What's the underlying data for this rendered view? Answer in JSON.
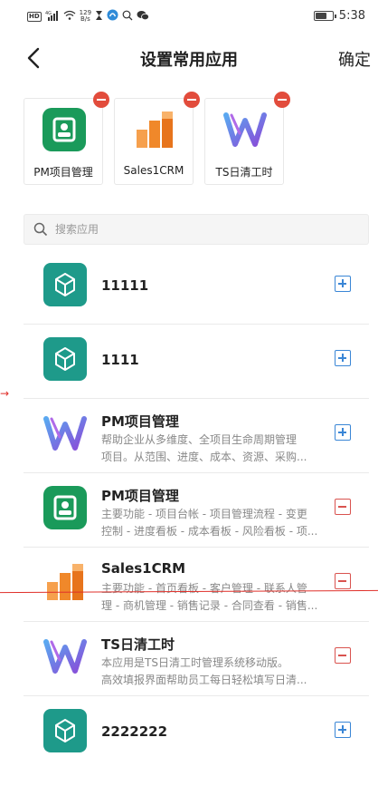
{
  "status_bar": {
    "hd_badge": "HD",
    "net_type": "4G",
    "net_speed_value": "129",
    "net_speed_unit": "B/s",
    "time": "5:38",
    "battery_level": 0.7,
    "icons": [
      "hd-icon",
      "signal-icon",
      "wifi-icon",
      "hourglass-icon",
      "app-icon",
      "search-icon",
      "wechat-icon",
      "battery-icon"
    ]
  },
  "header": {
    "title": "设置常用应用",
    "confirm_label": "确定",
    "back_icon": "chevron-left-icon"
  },
  "selected_apps": [
    {
      "label": "PM项目管理",
      "icon": "pm-green-icon"
    },
    {
      "label": "Sales1CRM",
      "icon": "sales-bars-icon"
    },
    {
      "label": "TS日清工时",
      "icon": "ts-wave-icon"
    }
  ],
  "search": {
    "placeholder": "搜索应用",
    "value": ""
  },
  "apps": [
    {
      "name": "11111",
      "desc": [],
      "icon": "cube-icon",
      "action": "add"
    },
    {
      "name": "1111",
      "desc": [],
      "icon": "cube-icon",
      "action": "add"
    },
    {
      "name": "PM项目管理",
      "desc": [
        "帮助企业从多维度、全项目生命周期管理",
        "项目。从范围、进度、成本、资源、采购..."
      ],
      "icon": "ts-wave-icon",
      "action": "add"
    },
    {
      "name": "PM项目管理",
      "desc": [
        "主要功能 - 项目台帐 - 项目管理流程 - 变更",
        "控制 - 进度看板 - 成本看板 - 风险看板 - 项..."
      ],
      "icon": "pm-green-icon",
      "action": "remove"
    },
    {
      "name": "Sales1CRM",
      "desc": [
        "主要功能 - 首页看板 - 客户管理 - 联系人管",
        "理 - 商机管理 - 销售记录 - 合同查看 - 销售..."
      ],
      "icon": "sales-bars-icon",
      "action": "remove"
    },
    {
      "name": "TS日清工时",
      "desc": [
        "本应用是TS日清工时管理系统移动版。",
        "高效填报界面帮助员工每日轻松填写日清..."
      ],
      "icon": "ts-wave-icon",
      "action": "remove"
    },
    {
      "name": "2222222",
      "desc": [],
      "icon": "cube-icon",
      "action": "add"
    }
  ],
  "colors": {
    "accent_blue": "#3a86d6",
    "remove_red": "#d9534f",
    "badge_red": "#e24c3c",
    "teal": "#1e9a8a",
    "pm_green": "#1a9a5a",
    "sales_orange": "#f0882a"
  }
}
